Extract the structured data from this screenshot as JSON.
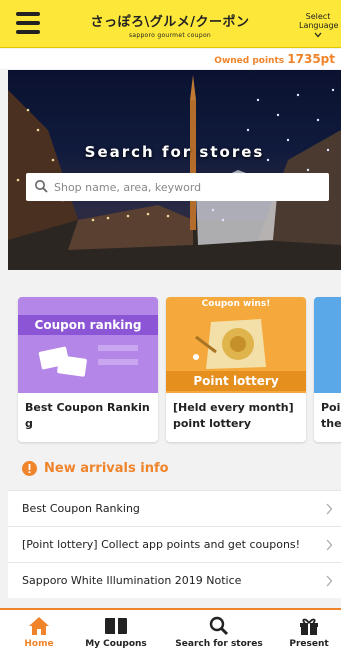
{
  "header": {
    "logo_text": "さっぽろ\\グルメ/クーポン",
    "logo_sub": "sapporo gourmet coupon",
    "lang_line1": "Select",
    "lang_line2": "Language"
  },
  "points": {
    "label": "Owned points ",
    "value": "1735pt"
  },
  "hero": {
    "title": "Search for stores"
  },
  "search": {
    "placeholder": "Shop name, area, keyword"
  },
  "cards": [
    {
      "banner": "Coupon ranking",
      "text": "Best Coupon Rankin g"
    },
    {
      "banner_top": "Coupon wins!",
      "banner": "Point lottery",
      "text": "[Held every month] point lottery"
    },
    {
      "text": "Poi the"
    }
  ],
  "section": {
    "title": "New arrivals info"
  },
  "news": [
    {
      "label": "Best Coupon Ranking"
    },
    {
      "label": "[Point lottery] Collect app points and get coupons!"
    },
    {
      "label": "Sapporo White Illumination 2019 Notice"
    }
  ],
  "tabs": [
    {
      "label": "Home"
    },
    {
      "label": "My Coupons"
    },
    {
      "label": "Search for stores"
    },
    {
      "label": "Present"
    }
  ],
  "colors": {
    "accent": "#f0842b",
    "header": "#fde83a",
    "ranking": "#a779e0",
    "lottery": "#f5a93c"
  }
}
